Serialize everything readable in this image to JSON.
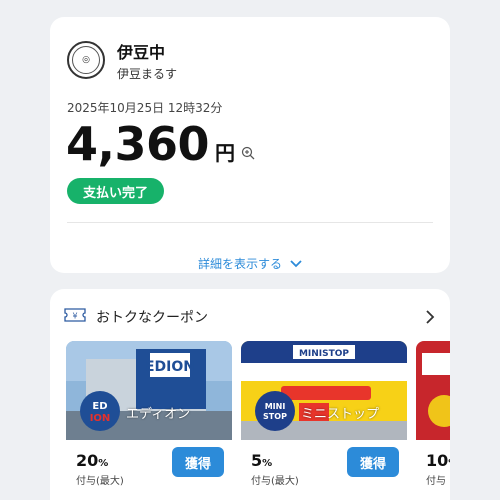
{
  "payment": {
    "store_name": "伊豆中",
    "store_sub": "伊豆まるす",
    "datetime": "2025年10月25日 12時32分",
    "amount": "4,360",
    "unit": "円",
    "status": "支払い完了",
    "details_label": "詳細を表示する"
  },
  "coupons": {
    "title": "おトクなクーポン",
    "items": [
      {
        "brand": "エディオン",
        "pct": "20",
        "pct_unit": "%",
        "note": "付与(最大)",
        "button": "獲得"
      },
      {
        "brand": "ミニストップ",
        "pct": "5",
        "pct_unit": "%",
        "note": "付与(最大)",
        "button": "獲得"
      },
      {
        "brand": "",
        "pct": "10",
        "pct_unit": "%",
        "note": "付与",
        "button": ""
      }
    ]
  },
  "colors": {
    "accent": "#2c8bd9",
    "success": "#17b26a"
  },
  "icons": [
    "zoom-in-icon",
    "chevron-down-icon",
    "coupon-ticket-icon",
    "chevron-right-icon"
  ]
}
